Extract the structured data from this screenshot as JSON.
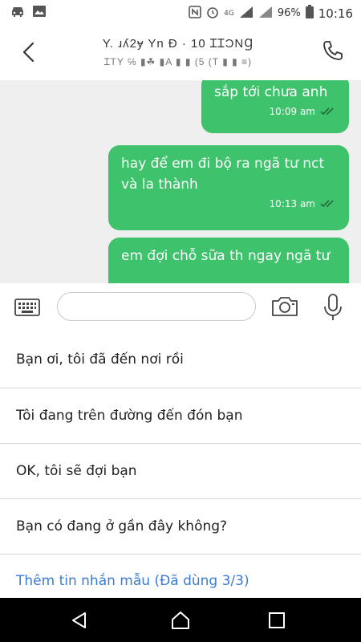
{
  "status_bar": {
    "time": "10:16",
    "battery_percent": "96%",
    "network": "4G",
    "icons": [
      "car-icon",
      "image-icon",
      "nfc-icon",
      "alarm-icon",
      "signal-icon",
      "battery-icon"
    ]
  },
  "header": {
    "title": "Y. ɹʎ2ɏ Yn Đ · 10 ꞮꞮƆNꞬ",
    "subtitle": "ꞮTY ℅ ▮☘ ▮A ▮ ▮ (5 (T ▮ ▮ ≡)",
    "back_icon": "back-arrow-icon",
    "call_icon": "phone-icon"
  },
  "messages": [
    {
      "text": "sắp tới chưa anh",
      "time": "10:09 am",
      "status": "read"
    },
    {
      "text": "hay để em đi bộ ra ngã tư nct và la thành",
      "time": "10:13 am",
      "status": "read"
    },
    {
      "text": "em đợi chỗ sữa th ngay ngã tư",
      "time": "",
      "status": ""
    }
  ],
  "composer": {
    "input_value": "",
    "input_placeholder": ""
  },
  "quick_replies": [
    "Bạn ơi, tôi đã đến nơi rồi",
    "Tôi đang trên đường đến đón bạn",
    "OK, tôi sẽ đợi bạn",
    "Bạn có đang ở gần đây không?"
  ],
  "add_template_label": "Thêm tin nhắn mẫu (Đã dùng 3/3)",
  "colors": {
    "bubble": "#3ec26b",
    "link": "#3a7bd5",
    "chat_bg": "#efefef"
  }
}
